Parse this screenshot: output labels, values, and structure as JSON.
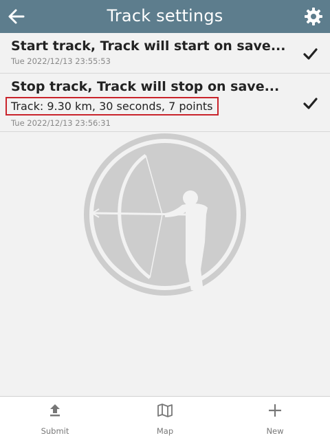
{
  "header": {
    "title": "Track settings",
    "back_icon": "arrow-left-icon",
    "settings_icon": "gear-icon",
    "background": "#5d7d8d"
  },
  "entries": [
    {
      "title": "Start track, Track will start on save...",
      "date": "Tue 2022/12/13 23:55:53",
      "status_icon": "checkmark-icon"
    },
    {
      "title": "Stop track, Track will stop on save...",
      "detail": "Track: 9.30 km, 30 seconds, 7 points",
      "date": "Tue 2022/12/13 23:56:31",
      "status_icon": "checkmark-icon",
      "highlight_color": "#c9232b"
    }
  ],
  "watermark_icon": "archer-logo-icon",
  "bottom_nav": [
    {
      "label": "Submit",
      "icon": "upload-icon"
    },
    {
      "label": "Map",
      "icon": "map-icon"
    },
    {
      "label": "New",
      "icon": "plus-icon"
    }
  ]
}
